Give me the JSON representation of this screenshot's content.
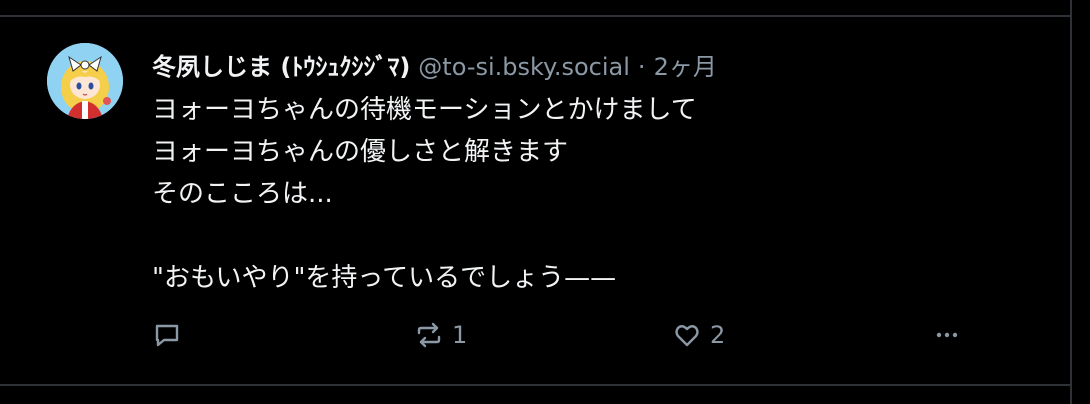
{
  "post": {
    "display_name": "冬夙しじま (ﾄｳｼｭｸｼｼﾞﾏ)",
    "handle": "@to-si.bsky.social",
    "separator": "·",
    "timestamp": "2ヶ月",
    "lines": [
      "ヨォーヨちゃんの待機モーションとかけまして",
      "ヨォーヨちゃんの優しさと解きます",
      "そのこころは...",
      "",
      "\"おもいやり\"を持っているでしょう——"
    ],
    "actions": {
      "reply_icon": "speech-bubble-icon",
      "repost_icon": "repost-arrows-icon",
      "repost_count": "1",
      "like_icon": "heart-icon",
      "like_count": "2",
      "more_icon": "ellipsis-icon"
    }
  },
  "colors": {
    "background": "#000000",
    "text": "#f1f3f5",
    "muted": "#8b98a5",
    "border": "#2e3135"
  }
}
